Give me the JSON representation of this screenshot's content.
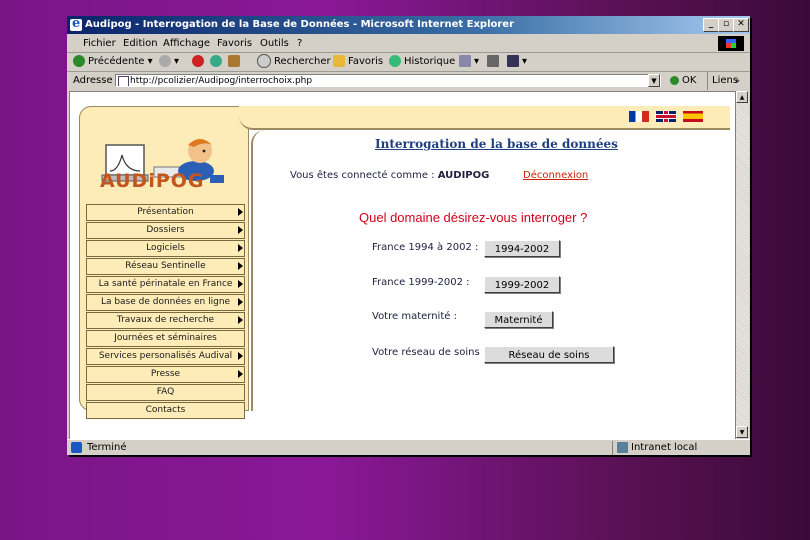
{
  "window": {
    "title": "Audipog - Interrogation de la Base de Données - Microsoft Internet Explorer",
    "min": "_",
    "max": "▫",
    "close": "✕"
  },
  "menu": [
    "Fichier",
    "Edition",
    "Affichage",
    "Favoris",
    "Outils",
    "?"
  ],
  "toolbar": {
    "back": "Précédente",
    "search": "Rechercher",
    "favorites": "Favoris",
    "history": "Historique"
  },
  "address": {
    "label": "Adresse",
    "url": "http://pcolizier/Audipog/interrochoix.php",
    "go": "OK",
    "links": "Liens"
  },
  "status": {
    "left": "Terminé",
    "zone": "Intranet local"
  },
  "site": {
    "logo_text": "AUDiPOG",
    "nav": [
      {
        "label": "Présentation",
        "arrow": true
      },
      {
        "label": "Dossiers",
        "arrow": true
      },
      {
        "label": "Logiciels",
        "arrow": true
      },
      {
        "label": "Réseau Sentinelle",
        "arrow": true
      },
      {
        "label": "La santé périnatale en France",
        "arrow": true
      },
      {
        "label": "La base de données en ligne",
        "arrow": true
      },
      {
        "label": "Travaux de recherche",
        "arrow": true
      },
      {
        "label": "Journées et séminaires",
        "arrow": false
      },
      {
        "label": "Services personalisés Audival",
        "arrow": true
      },
      {
        "label": "Presse",
        "arrow": true
      },
      {
        "label": "FAQ",
        "arrow": false
      },
      {
        "label": "Contacts",
        "arrow": false
      }
    ],
    "heading": "Interrogation de la base de données",
    "connected_text": "Vous êtes connecté comme :",
    "connected_user": "AUDIPOG",
    "logout": "Déconnexion",
    "question": "Quel domaine désirez-vous interroger ?",
    "rows": [
      {
        "label": "France 1994 à 2002 :",
        "button": "1994-2002"
      },
      {
        "label": "France 1999-2002 :",
        "button": "1999-2002"
      },
      {
        "label": "Votre maternité :",
        "button": "Maternité"
      },
      {
        "label": "Votre réseau de soins :",
        "button": "Réseau de soins"
      }
    ]
  },
  "colors": {
    "accent_red": "#d4001a",
    "cream": "#fdebb8",
    "title_blue": "#0a246a"
  }
}
